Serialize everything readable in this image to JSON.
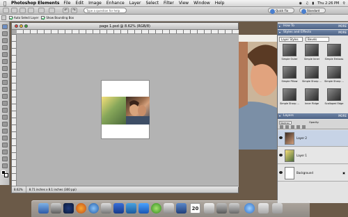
{
  "menubar": {
    "app_name": "Photoshop Elements",
    "items": [
      "File",
      "Edit",
      "Image",
      "Enhance",
      "Layer",
      "Select",
      "Filter",
      "View",
      "Window",
      "Help"
    ],
    "clock": "Thu 2:26 PM"
  },
  "options": {
    "help_placeholder": "Type a question for help",
    "quick_fix": "Quick Fix",
    "standard_edit": "Standard Edit",
    "auto_select_layer": "Auto Select Layer",
    "show_bounding_box": "Show Bounding Box"
  },
  "document": {
    "title": "page 1.psd @ 8.62% (RGB/8)",
    "zoom": "8.62%",
    "dimensions": "8.71 inches x 8.1 inches (300 ppi)"
  },
  "palettes": {
    "how_to": "How To",
    "styles_effects": "Styles and Effects",
    "more": "MORE",
    "dropdown_left": "Layer Styles",
    "dropdown_right": "Bevels",
    "styles": [
      "Simple Outer",
      "Simple Inner",
      "Simple Emboss",
      "Simple Pillow",
      "Simple Sharp ...",
      "Simple Sharp ...",
      "Simple Sharp ...",
      "Inner Ridge",
      "Scalloped Edge"
    ],
    "layers_title": "Layers",
    "blend_mode": "Normal",
    "opacity_label": "Opacity:",
    "layers": [
      "Layer 2",
      "Layer 1",
      "Background"
    ]
  },
  "dock": {
    "calendar_day": "20"
  },
  "colors": {
    "panel_header": "#5b7090",
    "canvas_bg": "#b3b3b3"
  }
}
